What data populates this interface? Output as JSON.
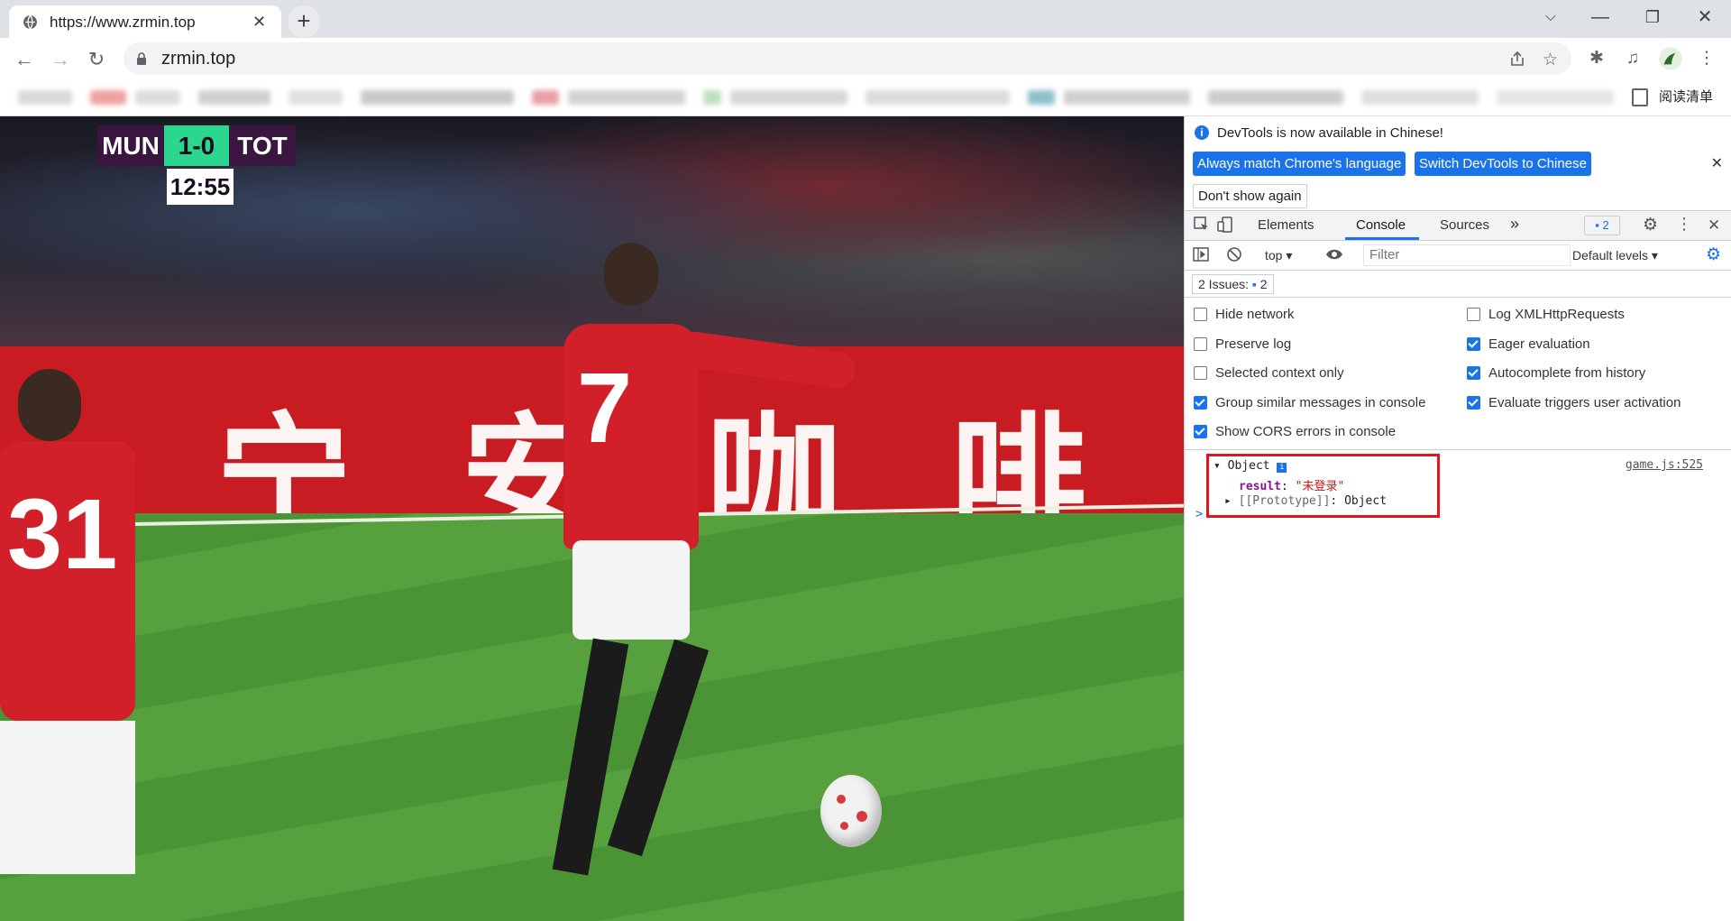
{
  "browser": {
    "tab": {
      "title": "https://www.zrmin.top",
      "close_glyph": "✕"
    },
    "new_tab_glyph": "+",
    "window_controls": {
      "tabsearch": "⌵",
      "minimize": "—",
      "restore": "❐",
      "close": "✕"
    },
    "nav": {
      "back": "←",
      "forward": "→",
      "reload": "↻"
    },
    "url": "zrmin.top",
    "reading_list_label": "阅读清单",
    "icons": {
      "share": "share-icon",
      "bookmark": "star-icon",
      "extensions": "puzzle-icon",
      "media": "media-icon",
      "profile": "avatar-icon",
      "menu": "kebab-icon"
    }
  },
  "video": {
    "scoreboard": {
      "home": "MUN",
      "score": "1-0",
      "away": "TOT",
      "clock": "12:55"
    },
    "player_numbers": {
      "main": "7",
      "left": "31"
    },
    "ad_chars": "宁 安 咖 啡"
  },
  "devtools": {
    "infobar": {
      "message": "DevTools is now available in Chinese!",
      "btn_match": "Always match Chrome's language",
      "btn_switch": "Switch DevTools to Chinese",
      "btn_dont_show": "Don't show again"
    },
    "tabs": [
      "Elements",
      "Console",
      "Sources"
    ],
    "more_tabs": "»",
    "message_count": "2",
    "context": "top",
    "filter_placeholder": "Filter",
    "levels": "Default levels",
    "issues": {
      "label": "2 Issues:",
      "count": "2"
    },
    "settings_left": [
      {
        "label": "Hide network",
        "checked": false
      },
      {
        "label": "Preserve log",
        "checked": false
      },
      {
        "label": "Selected context only",
        "checked": false
      },
      {
        "label": "Group similar messages in console",
        "checked": true
      },
      {
        "label": "Show CORS errors in console",
        "checked": true
      }
    ],
    "settings_right": [
      {
        "label": "Log XMLHttpRequests",
        "checked": false
      },
      {
        "label": "Eager evaluation",
        "checked": true
      },
      {
        "label": "Autocomplete from history",
        "checked": true
      },
      {
        "label": "Evaluate triggers user activation",
        "checked": true
      }
    ],
    "console": {
      "object_label": "Object",
      "result_key": "result",
      "result_value": "\"未登录\"",
      "prototype": "[[Prototype]]",
      "prototype_value": "Object",
      "source": "game.js:525",
      "prompt": ">"
    },
    "colors": {
      "accent": "#1a73e8",
      "highlight": "#e0151f",
      "string": "#c41a16",
      "key": "#881391"
    }
  }
}
